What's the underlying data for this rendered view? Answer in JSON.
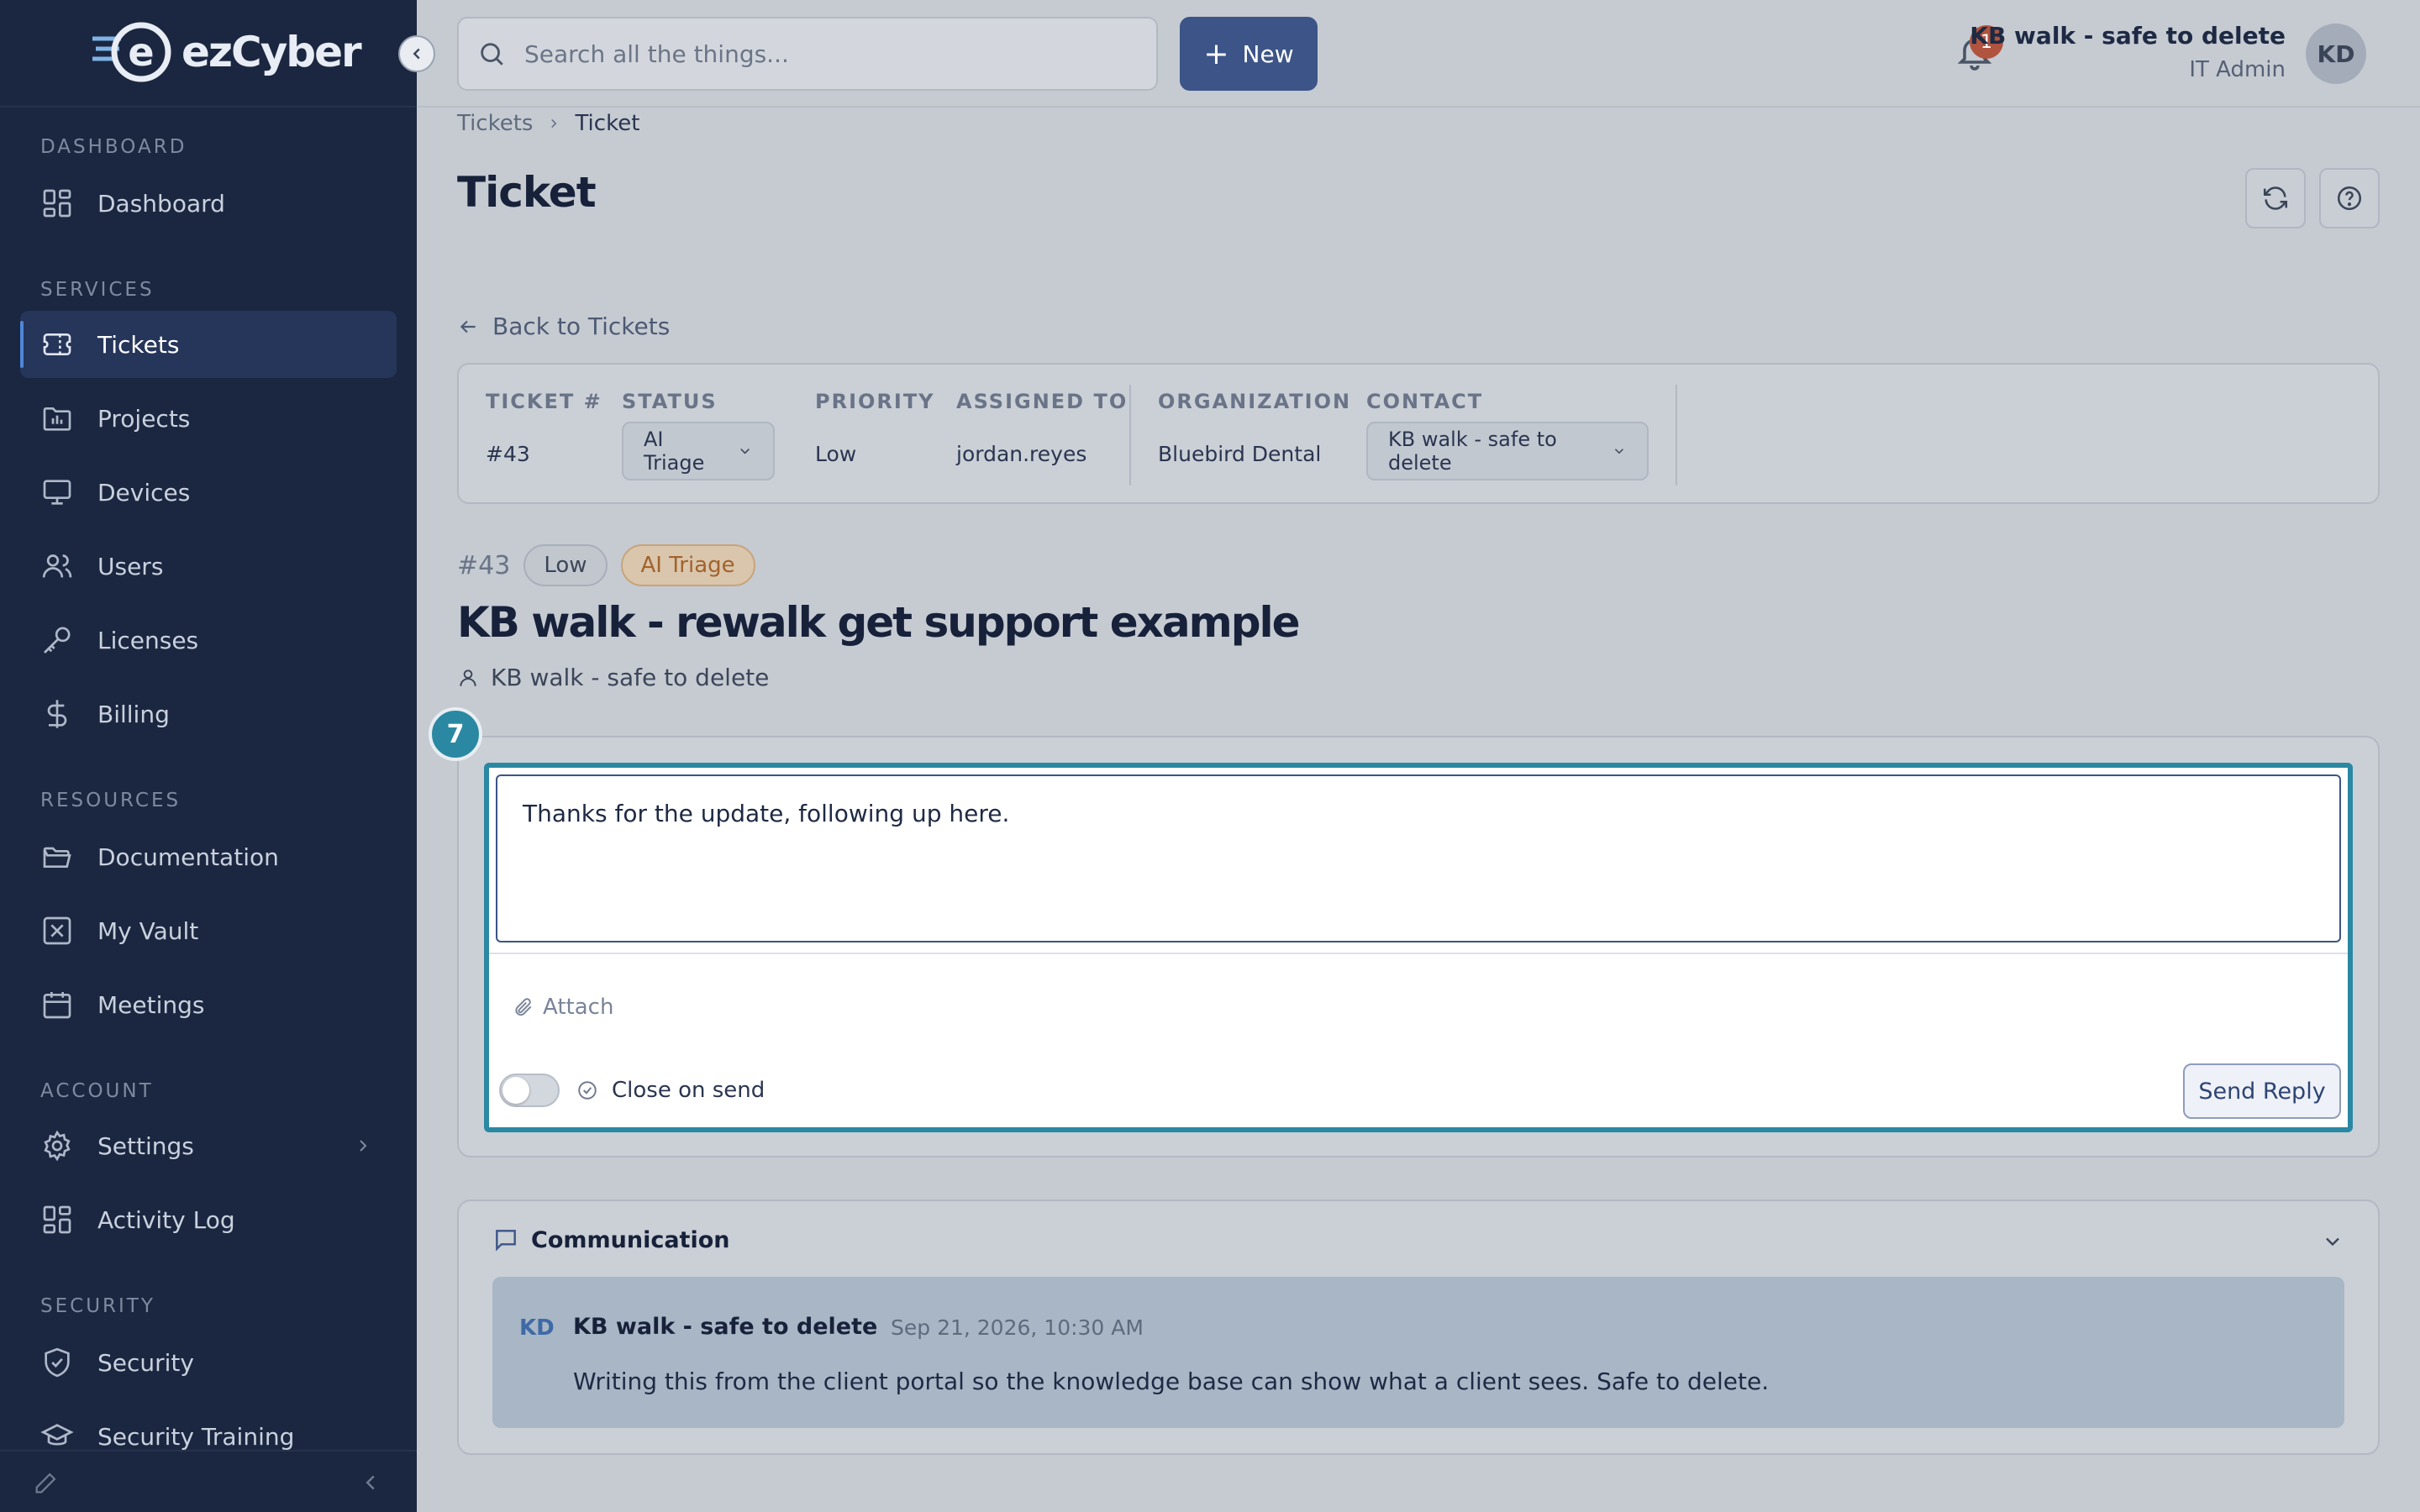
{
  "app": {
    "logo_text": "ezCyber",
    "logo_mark": "e"
  },
  "sidebar": {
    "sections": {
      "dashboard": "DASHBOARD",
      "services": "SERVICES",
      "resources": "RESOURCES",
      "account": "ACCOUNT",
      "security": "SECURITY"
    },
    "items": {
      "dashboard": "Dashboard",
      "tickets": "Tickets",
      "projects": "Projects",
      "devices": "Devices",
      "users": "Users",
      "licenses": "Licenses",
      "billing": "Billing",
      "documentation": "Documentation",
      "vault": "My Vault",
      "meetings": "Meetings",
      "settings": "Settings",
      "activity": "Activity Log",
      "security": "Security",
      "training": "Security Training"
    },
    "active_item": "Tickets"
  },
  "topbar": {
    "search_placeholder": "Search all the things...",
    "new_label": "New",
    "notification_count": "1",
    "user_name": "KB walk - safe to delete",
    "user_role": "IT Admin",
    "user_initials": "KD"
  },
  "breadcrumb": {
    "parent": "Tickets",
    "current": "Ticket"
  },
  "page": {
    "title": "Ticket",
    "back_label": "Back to Tickets"
  },
  "ticket_info": {
    "ticket_label": "TICKET #",
    "ticket_value": "#43",
    "status_label": "STATUS",
    "status_value": "AI Triage",
    "priority_label": "PRIORITY",
    "priority_value": "Low",
    "assigned_label": "ASSIGNED TO",
    "assigned_value": "jordan.reyes",
    "org_label": "ORGANIZATION",
    "org_value": "Bluebird Dental",
    "contact_label": "CONTACT",
    "contact_value": "KB walk - safe to delete"
  },
  "ticket": {
    "number": "#43",
    "priority_badge": "Low",
    "status_badge": "AI Triage",
    "title": "KB walk - rewalk get support example",
    "contact": "KB walk - safe to delete"
  },
  "reply": {
    "step": "7",
    "text": "Thanks for the update, following up here.",
    "attach_label": "Attach",
    "close_on_send_label": "Close on send",
    "close_on_send": false,
    "send_label": "Send Reply"
  },
  "communication": {
    "title": "Communication",
    "messages": [
      {
        "initials": "KD",
        "author": "KB walk - safe to delete",
        "time": "Sep 21, 2026, 10:30 AM",
        "body": "Writing this from the client portal so the knowledge base can show what a client sees. Safe to delete."
      }
    ]
  },
  "colors": {
    "sidebar_bg": "#1b2740",
    "accent": "#3c5488",
    "highlight": "#2a88a3",
    "triage_badge": "#a2622c",
    "notification": "#b0533f"
  }
}
